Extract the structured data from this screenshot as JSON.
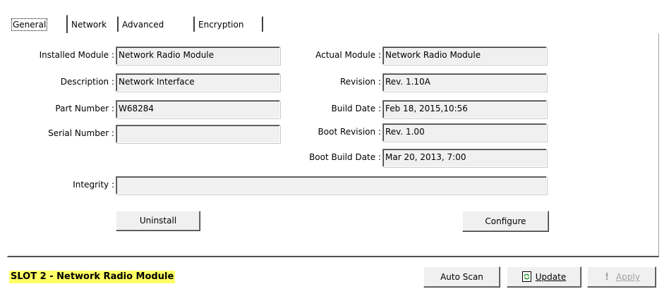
{
  "tabs": [
    {
      "label": "General",
      "active": true
    },
    {
      "label": "Network",
      "active": false
    },
    {
      "label": "Advanced",
      "active": false
    },
    {
      "label": "Encryption",
      "active": false
    }
  ],
  "general": {
    "installed_module_label": "Installed Module :",
    "installed_module_value": "Network Radio Module",
    "description_label": "Description :",
    "description_value": "Network Interface",
    "part_number_label": "Part Number :",
    "part_number_value": "W68284",
    "serial_number_label": "Serial Number :",
    "serial_number_value": "",
    "actual_module_label": "Actual Module :",
    "actual_module_value": "Network Radio Module",
    "revision_label": "Revision :",
    "revision_value": "Rev. 1.10A",
    "build_date_label": "Build Date :",
    "build_date_value": "Feb 18, 2015,10:56",
    "boot_revision_label": "Boot Revision :",
    "boot_revision_value": "Rev. 1.00",
    "boot_build_date_label": "Boot Build Date :",
    "boot_build_date_value": "Mar 20, 2013, 7:00",
    "integrity_label": "Integrity :",
    "integrity_value": "",
    "uninstall_label": "Uninstall",
    "configure_label": "Configure"
  },
  "footer": {
    "status": "SLOT 2 - Network Radio Module",
    "autoscan_label": "Auto Scan",
    "update_label": "Update",
    "apply_label": "Apply",
    "apply_icon": "!"
  },
  "icons": {
    "update": "refresh-icon",
    "apply": "exclamation-icon"
  },
  "colors": {
    "status_highlight": "#ffff66",
    "field_background": "#f0f0f0",
    "disabled_text": "#a0a0a0"
  }
}
